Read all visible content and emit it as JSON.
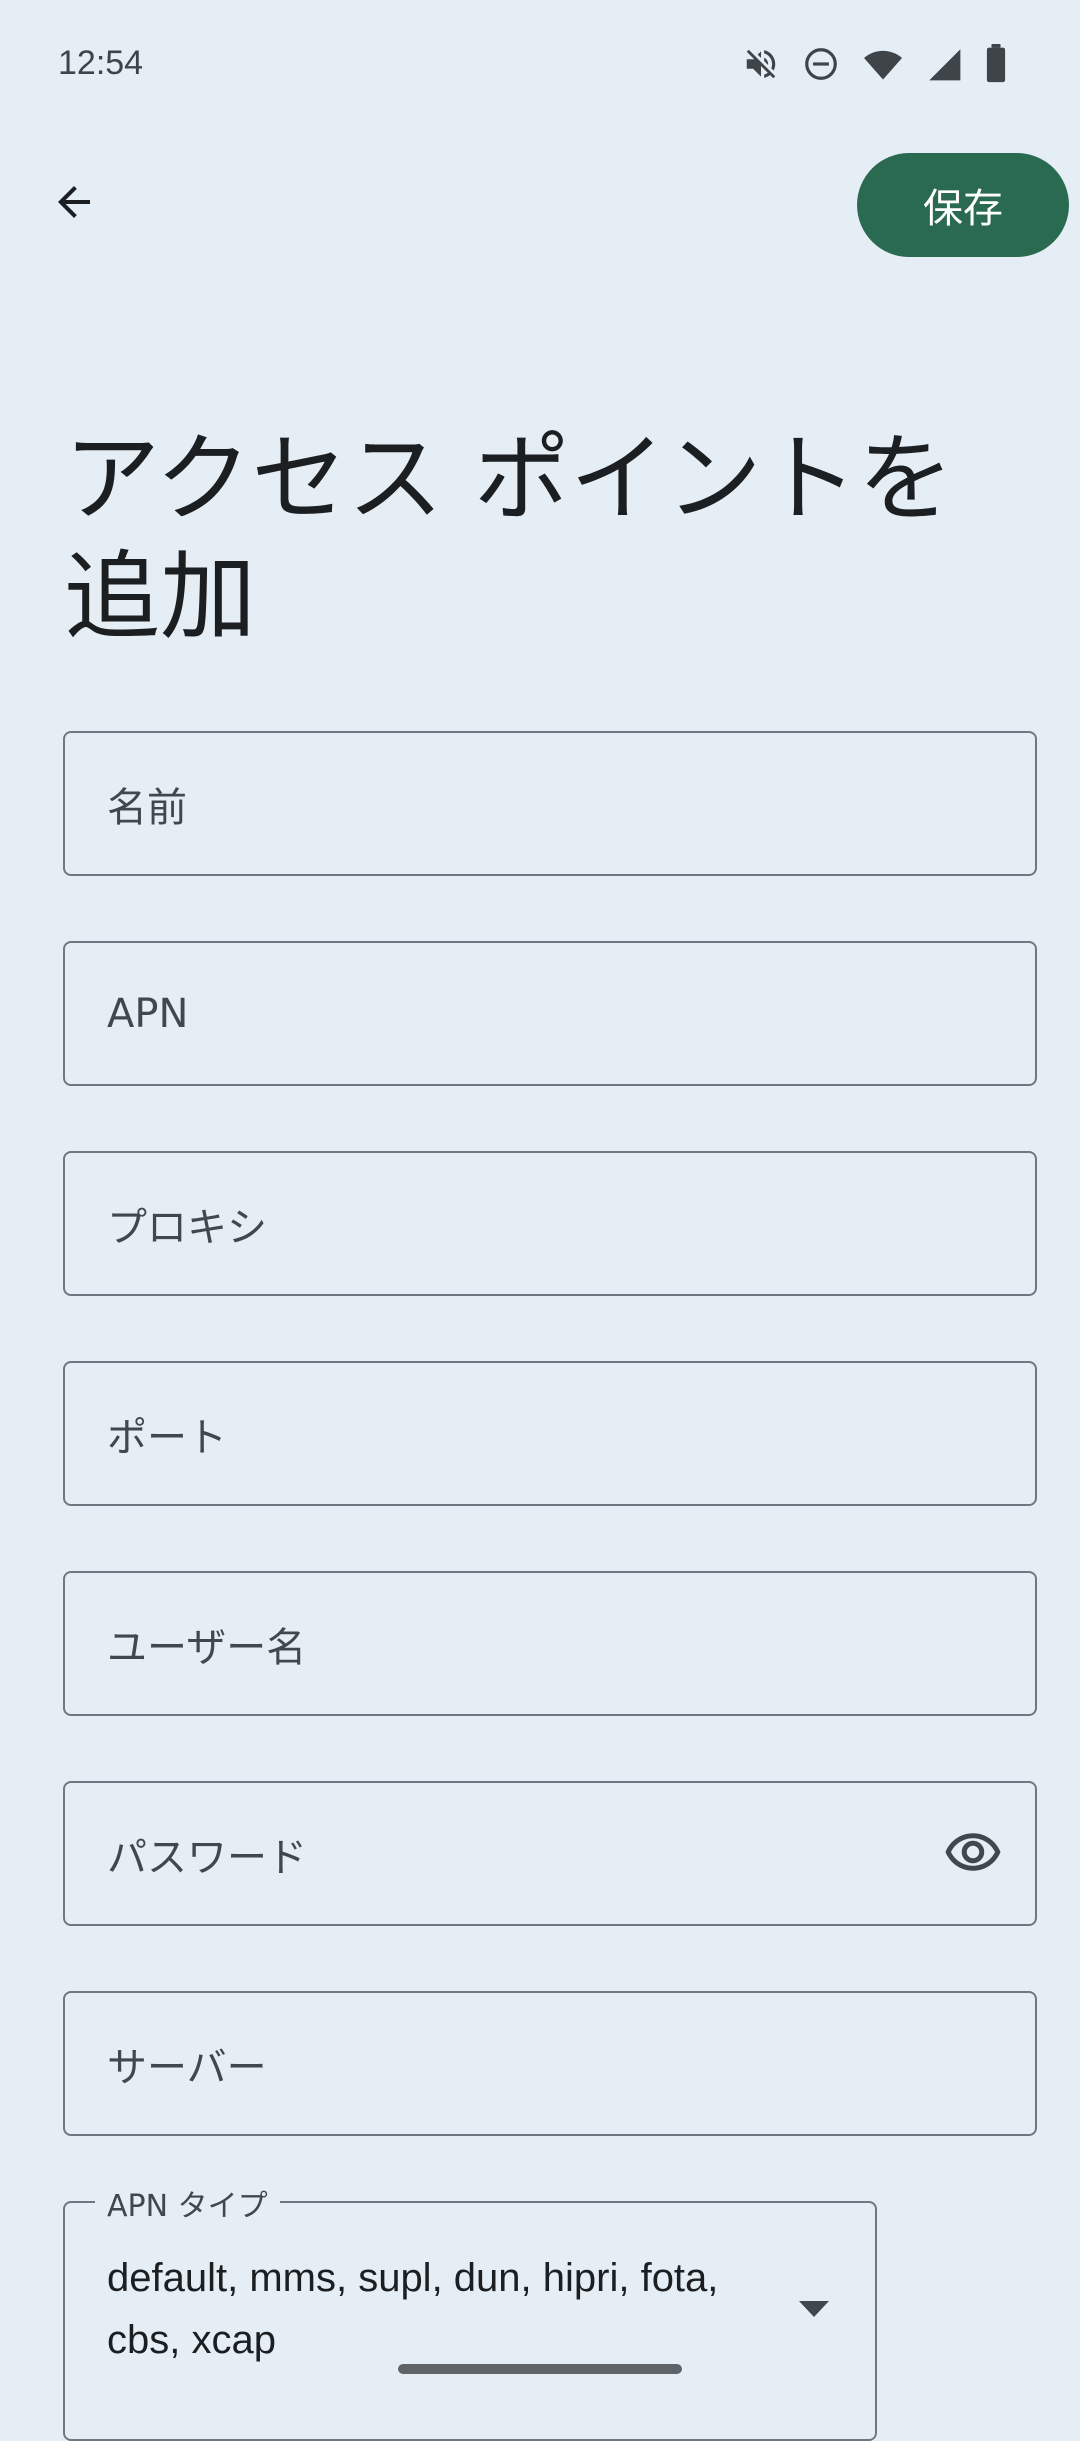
{
  "status_bar": {
    "time": "12:54",
    "icons": [
      "mute-icon",
      "do-not-disturb-icon",
      "wifi-icon",
      "cell-signal-icon",
      "battery-icon"
    ]
  },
  "app_bar": {
    "back_icon": "arrow-back-icon",
    "save_label": "保存"
  },
  "title": "アクセス ポイントを追加",
  "fields": {
    "name": "名前",
    "apn": "APN",
    "proxy": "プロキシ",
    "port": "ポート",
    "username": "ユーザー名",
    "password": "パスワード",
    "server": "サーバー"
  },
  "apn_type": {
    "label": "APN タイプ",
    "value": "default, mms, supl, dun, hipri, fota, cbs, xcap"
  },
  "colors": {
    "background": "#e6eef5",
    "accent": "#2a6a51",
    "outline": "#6f7880",
    "text": "#1b1f22"
  }
}
